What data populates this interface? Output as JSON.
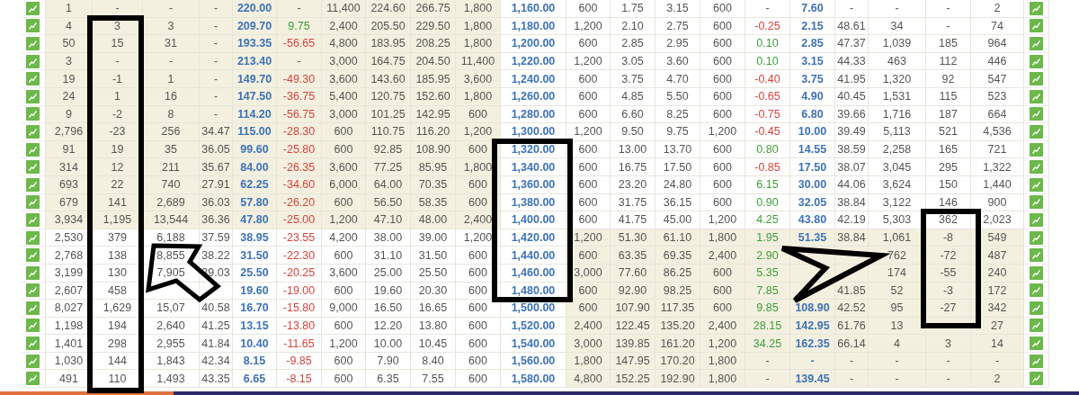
{
  "rows": [
    {
      "strike": "1,160.00",
      "call_itm": true,
      "put_itm": false,
      "call": {
        "oi": "1",
        "chg_oi": "-",
        "vol": "-",
        "iv": "-",
        "ltp": "220.00",
        "chg": "-",
        "bq": "11,400",
        "bid": "224.60",
        "ask": "266.75",
        "aq": "1,800"
      },
      "put": {
        "bq": "600",
        "bid": "1.75",
        "ask": "3.15",
        "aq": "600",
        "chg": "-",
        "ltp": "7.60",
        "iv": "-",
        "vol": "-",
        "chg_oi": "-",
        "oi": "2"
      }
    },
    {
      "strike": "1,180.00",
      "call_itm": true,
      "put_itm": false,
      "call": {
        "oi": "4",
        "chg_oi": "3",
        "vol": "3",
        "iv": "-",
        "ltp": "209.70",
        "chg": "9.75",
        "color": "#3f9e3a",
        "bq": "2,400",
        "bid": "205.50",
        "ask": "229.50",
        "aq": "1,800"
      },
      "put": {
        "bq": "1,200",
        "bid": "2.10",
        "ask": "2.75",
        "aq": "600",
        "chg": "-0.25",
        "color": "#d8433f",
        "ltp": "2.15",
        "iv": "48.61",
        "vol": "34",
        "chg_oi": "-",
        "oi": "74"
      }
    },
    {
      "strike": "1,200.00",
      "call_itm": true,
      "put_itm": false,
      "call": {
        "oi": "50",
        "chg_oi": "15",
        "vol": "31",
        "iv": "-",
        "ltp": "193.35",
        "chg": "-56.65",
        "color": "#d8433f",
        "bq": "4,800",
        "bid": "183.95",
        "ask": "208.25",
        "aq": "1,800"
      },
      "put": {
        "bq": "600",
        "bid": "2.85",
        "ask": "2.95",
        "aq": "600",
        "chg": "0.10",
        "color": "#3f9e3a",
        "ltp": "2.85",
        "iv": "47.37",
        "vol": "1,039",
        "chg_oi": "185",
        "oi": "964"
      }
    },
    {
      "strike": "1,220.00",
      "call_itm": true,
      "put_itm": false,
      "call": {
        "oi": "3",
        "chg_oi": "-",
        "vol": "-",
        "iv": "-",
        "ltp": "213.40",
        "chg": "-",
        "bq": "3,000",
        "bid": "164.75",
        "ask": "204.50",
        "aq": "11,400"
      },
      "put": {
        "bq": "1,200",
        "bid": "3.05",
        "ask": "3.60",
        "aq": "600",
        "chg": "0.10",
        "color": "#3f9e3a",
        "ltp": "3.15",
        "iv": "44.33",
        "vol": "463",
        "chg_oi": "112",
        "oi": "446"
      }
    },
    {
      "strike": "1,240.00",
      "call_itm": true,
      "put_itm": false,
      "call": {
        "oi": "19",
        "chg_oi": "-1",
        "vol": "1",
        "iv": "-",
        "ltp": "149.70",
        "chg": "-49.30",
        "color": "#d8433f",
        "bq": "3,600",
        "bid": "143.60",
        "ask": "185.95",
        "aq": "3,600"
      },
      "put": {
        "bq": "600",
        "bid": "3.75",
        "ask": "4.70",
        "aq": "600",
        "chg": "-0.40",
        "color": "#d8433f",
        "ltp": "3.75",
        "iv": "41.95",
        "vol": "1,320",
        "chg_oi": "92",
        "oi": "547"
      }
    },
    {
      "strike": "1,260.00",
      "call_itm": true,
      "put_itm": false,
      "call": {
        "oi": "24",
        "chg_oi": "1",
        "vol": "16",
        "iv": "-",
        "ltp": "147.50",
        "chg": "-36.75",
        "color": "#d8433f",
        "bq": "5,400",
        "bid": "120.75",
        "ask": "152.60",
        "aq": "1,800"
      },
      "put": {
        "bq": "600",
        "bid": "4.85",
        "ask": "5.50",
        "aq": "600",
        "chg": "-0.65",
        "color": "#d8433f",
        "ltp": "4.90",
        "iv": "40.45",
        "vol": "1,531",
        "chg_oi": "115",
        "oi": "523"
      }
    },
    {
      "strike": "1,280.00",
      "call_itm": true,
      "put_itm": false,
      "call": {
        "oi": "9",
        "chg_oi": "-2",
        "vol": "8",
        "iv": "-",
        "ltp": "114.20",
        "chg": "-56.75",
        "color": "#d8433f",
        "bq": "3,000",
        "bid": "101.25",
        "ask": "142.95",
        "aq": "600"
      },
      "put": {
        "bq": "600",
        "bid": "6.60",
        "ask": "8.25",
        "aq": "600",
        "chg": "-0.75",
        "color": "#d8433f",
        "ltp": "6.80",
        "iv": "39.66",
        "vol": "1,716",
        "chg_oi": "187",
        "oi": "664"
      }
    },
    {
      "strike": "1,300.00",
      "call_itm": true,
      "put_itm": false,
      "call": {
        "oi": "2,796",
        "chg_oi": "-23",
        "vol": "256",
        "iv": "34.47",
        "ltp": "115.00",
        "chg": "-28.30",
        "color": "#d8433f",
        "bq": "600",
        "bid": "110.75",
        "ask": "116.20",
        "aq": "1,200"
      },
      "put": {
        "bq": "1,200",
        "bid": "9.50",
        "ask": "9.75",
        "aq": "1,200",
        "chg": "-0.45",
        "color": "#d8433f",
        "ltp": "10.00",
        "iv": "39.49",
        "vol": "5,113",
        "chg_oi": "521",
        "oi": "4,536"
      }
    },
    {
      "strike": "1,320.00",
      "call_itm": true,
      "put_itm": false,
      "call": {
        "oi": "91",
        "chg_oi": "19",
        "vol": "35",
        "iv": "36.05",
        "ltp": "99.60",
        "chg": "-25.80",
        "color": "#d8433f",
        "bq": "600",
        "bid": "92.85",
        "ask": "108.90",
        "aq": "600"
      },
      "put": {
        "bq": "600",
        "bid": "13.00",
        "ask": "13.70",
        "aq": "600",
        "chg": "0.80",
        "color": "#3f9e3a",
        "ltp": "14.55",
        "iv": "38.59",
        "vol": "2,258",
        "chg_oi": "165",
        "oi": "721"
      }
    },
    {
      "strike": "1,340.00",
      "call_itm": true,
      "put_itm": false,
      "call": {
        "oi": "314",
        "chg_oi": "12",
        "vol": "211",
        "iv": "35.67",
        "ltp": "84.00",
        "chg": "-26.35",
        "color": "#d8433f",
        "bq": "3,600",
        "bid": "77.25",
        "ask": "85.95",
        "aq": "1,800"
      },
      "put": {
        "bq": "600",
        "bid": "16.75",
        "ask": "17.50",
        "aq": "600",
        "chg": "-0.85",
        "color": "#d8433f",
        "ltp": "17.50",
        "iv": "38.07",
        "vol": "3,045",
        "chg_oi": "295",
        "oi": "1,322"
      }
    },
    {
      "strike": "1,360.00",
      "call_itm": true,
      "put_itm": false,
      "call": {
        "oi": "693",
        "chg_oi": "22",
        "vol": "740",
        "iv": "27.91",
        "ltp": "62.25",
        "chg": "-34.60",
        "color": "#d8433f",
        "bq": "6,000",
        "bid": "64.00",
        "ask": "70.35",
        "aq": "600"
      },
      "put": {
        "bq": "600",
        "bid": "23.20",
        "ask": "24.80",
        "aq": "600",
        "chg": "6.15",
        "color": "#3f9e3a",
        "ltp": "30.00",
        "iv": "44.06",
        "vol": "3,624",
        "chg_oi": "150",
        "oi": "1,440"
      }
    },
    {
      "strike": "1,380.00",
      "call_itm": true,
      "put_itm": false,
      "call": {
        "oi": "679",
        "chg_oi": "141",
        "vol": "2,689",
        "iv": "36.03",
        "ltp": "57.80",
        "chg": "-26.20",
        "color": "#d8433f",
        "bq": "600",
        "bid": "56.50",
        "ask": "58.35",
        "aq": "600"
      },
      "put": {
        "bq": "600",
        "bid": "31.75",
        "ask": "36.15",
        "aq": "600",
        "chg": "0.90",
        "color": "#3f9e3a",
        "ltp": "32.05",
        "iv": "38.84",
        "vol": "3,122",
        "chg_oi": "146",
        "oi": "900"
      }
    },
    {
      "strike": "1,400.00",
      "call_itm": true,
      "put_itm": false,
      "call": {
        "oi": "3,934",
        "chg_oi": "1,195",
        "vol": "13,544",
        "iv": "36.36",
        "ltp": "47.80",
        "chg": "-25.00",
        "color": "#d8433f",
        "bq": "1,200",
        "bid": "47.10",
        "ask": "48.00",
        "aq": "2,400"
      },
      "put": {
        "bq": "600",
        "bid": "41.75",
        "ask": "45.00",
        "aq": "1,200",
        "chg": "4.25",
        "color": "#3f9e3a",
        "ltp": "43.80",
        "iv": "42.19",
        "vol": "5,303",
        "chg_oi": "362",
        "oi": "2,023"
      }
    },
    {
      "strike": "1,420.00",
      "call_itm": false,
      "put_itm": true,
      "call": {
        "oi": "2,530",
        "chg_oi": "379",
        "vol": "6,188",
        "iv": "37.59",
        "ltp": "38.95",
        "chg": "-23.55",
        "color": "#d8433f",
        "bq": "4,200",
        "bid": "38.00",
        "ask": "39.00",
        "aq": "1,200"
      },
      "put": {
        "bq": "1,200",
        "bid": "51.30",
        "ask": "61.10",
        "aq": "1,800",
        "chg": "1.95",
        "color": "#3f9e3a",
        "ltp": "51.35",
        "iv": "38.84",
        "vol": "1,061",
        "chg_oi": "-8",
        "oi": "549"
      }
    },
    {
      "strike": "1,440.00",
      "call_itm": false,
      "put_itm": true,
      "call": {
        "oi": "2,768",
        "chg_oi": "138",
        "vol": "8,855",
        "iv": "38.22",
        "ltp": "31.50",
        "chg": "-22.30",
        "color": "#d8433f",
        "bq": "600",
        "bid": "31.10",
        "ask": "31.50",
        "aq": "600"
      },
      "put": {
        "bq": "600",
        "bid": "63.35",
        "ask": "69.35",
        "aq": "2,400",
        "chg": "2.90",
        "color": "#3f9e3a",
        "vol": "762",
        "chg_oi": "-72",
        "oi": "487"
      }
    },
    {
      "strike": "1,460.00",
      "call_itm": false,
      "put_itm": true,
      "call": {
        "oi": "3,199",
        "chg_oi": "130",
        "vol": "7,905",
        "iv": "39.03",
        "ltp": "25.50",
        "chg": "-20.25",
        "color": "#d8433f",
        "bq": "3,600",
        "bid": "25.00",
        "ask": "25.50",
        "aq": "600"
      },
      "put": {
        "bq": "3,000",
        "bid": "77.60",
        "ask": "86.25",
        "aq": "600",
        "chg": "5.35",
        "color": "#3f9e3a",
        "vol": "174",
        "chg_oi": "-55",
        "oi": "240"
      }
    },
    {
      "strike": "1,480.00",
      "call_itm": false,
      "put_itm": true,
      "call": {
        "oi": "2,607",
        "chg_oi": "458",
        "ltp": "19.60",
        "chg": "-19.00",
        "color": "#d8433f",
        "bq": "600",
        "bid": "19.60",
        "ask": "20.30",
        "aq": "600"
      },
      "put": {
        "bq": "600",
        "bid": "92.90",
        "ask": "98.25",
        "aq": "600",
        "chg": "7.85",
        "color": "#3f9e3a",
        "iv": "41.85",
        "vol": "52",
        "chg_oi": "-3",
        "oi": "172"
      }
    },
    {
      "strike": "1,500.00",
      "call_itm": false,
      "put_itm": true,
      "call": {
        "oi": "8,027",
        "chg_oi": "1,629",
        "vol": "15,07",
        "iv": "40.58",
        "ltp": "16.70",
        "chg": "-15.80",
        "color": "#d8433f",
        "bq": "9,000",
        "bid": "16.50",
        "ask": "16.65",
        "aq": "600"
      },
      "put": {
        "bq": "600",
        "bid": "107.90",
        "ask": "117.35",
        "aq": "600",
        "chg": "9.85",
        "color": "#3f9e3a",
        "ltp": "108.90",
        "iv": "42.52",
        "vol": "95",
        "chg_oi": "-27",
        "oi": "342"
      }
    },
    {
      "strike": "1,520.00",
      "call_itm": false,
      "put_itm": true,
      "call": {
        "oi": "1,198",
        "chg_oi": "194",
        "vol": "2,640",
        "iv": "41.25",
        "ltp": "13.15",
        "chg": "-13.80",
        "color": "#d8433f",
        "bq": "600",
        "bid": "12.20",
        "ask": "13.80",
        "aq": "600"
      },
      "put": {
        "bq": "2,400",
        "bid": "122.45",
        "ask": "135.20",
        "aq": "2,400",
        "chg": "28.15",
        "color": "#3f9e3a",
        "ltp": "142.95",
        "iv": "61.76",
        "vol": "13",
        "oi": "27"
      }
    },
    {
      "strike": "1,540.00",
      "call_itm": false,
      "put_itm": true,
      "call": {
        "oi": "1,401",
        "chg_oi": "298",
        "vol": "2,955",
        "iv": "41.84",
        "ltp": "10.40",
        "chg": "-11.65",
        "color": "#d8433f",
        "bq": "1,200",
        "bid": "10.00",
        "ask": "10.45",
        "aq": "600"
      },
      "put": {
        "bq": "3,000",
        "bid": "139.85",
        "ask": "161.20",
        "aq": "1,200",
        "chg": "34.25",
        "color": "#3f9e3a",
        "ltp": "162.35",
        "iv": "66.14",
        "vol": "4",
        "chg_oi": "3",
        "oi": "14"
      }
    },
    {
      "strike": "1,560.00",
      "call_itm": false,
      "put_itm": true,
      "call": {
        "oi": "1,030",
        "chg_oi": "144",
        "vol": "1,843",
        "iv": "42.34",
        "ltp": "8.15",
        "chg": "-9.85",
        "color": "#d8433f",
        "bq": "600",
        "bid": "7.90",
        "ask": "8.40",
        "aq": "600"
      },
      "put": {
        "bq": "1,800",
        "bid": "147.95",
        "ask": "170.20",
        "aq": "1,800",
        "chg": "-",
        "ltp": "-",
        "iv": "-",
        "vol": "-",
        "chg_oi": "-",
        "oi": "-"
      }
    },
    {
      "strike": "1,580.00",
      "call_itm": false,
      "put_itm": true,
      "call": {
        "oi": "491",
        "chg_oi": "110",
        "vol": "1,493",
        "iv": "43.35",
        "ltp": "6.65",
        "chg": "-8.15",
        "color": "#d8433f",
        "bq": "600",
        "bid": "6.35",
        "ask": "7.55",
        "aq": "600"
      },
      "put": {
        "bq": "4,800",
        "bid": "152.25",
        "ask": "192.90",
        "aq": "1,800",
        "chg": "-",
        "ltp": "139.45",
        "iv": "-",
        "vol": "-",
        "chg_oi": "-",
        "oi": "2"
      }
    }
  ]
}
